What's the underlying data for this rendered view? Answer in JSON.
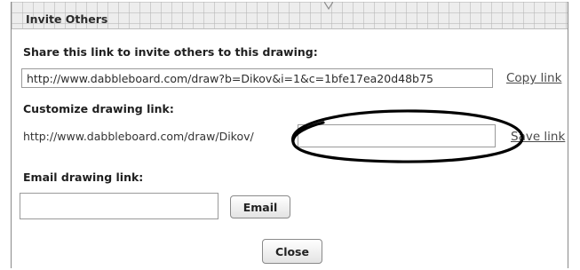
{
  "dialog": {
    "title": "Invite Others",
    "share": {
      "label": "Share this link to invite others to this drawing:",
      "url_value": "http://www.dabbleboard.com/draw?b=Dikov&i=1&c=1bfe17ea20d48b75",
      "copy_label": "Copy link"
    },
    "customize": {
      "label": "Customize drawing link:",
      "prefix": "http://www.dabbleboard.com/draw/Dikov/",
      "value": "",
      "save_label": "Save link"
    },
    "email": {
      "label": "Email drawing link:",
      "value": "",
      "button_label": "Email"
    },
    "close_label": "Close"
  },
  "colors": {
    "titlebar_bg": "#ededed",
    "annotation_ellipse": "#000000"
  },
  "icons": {
    "annotation": "hand-drawn-ellipse"
  }
}
